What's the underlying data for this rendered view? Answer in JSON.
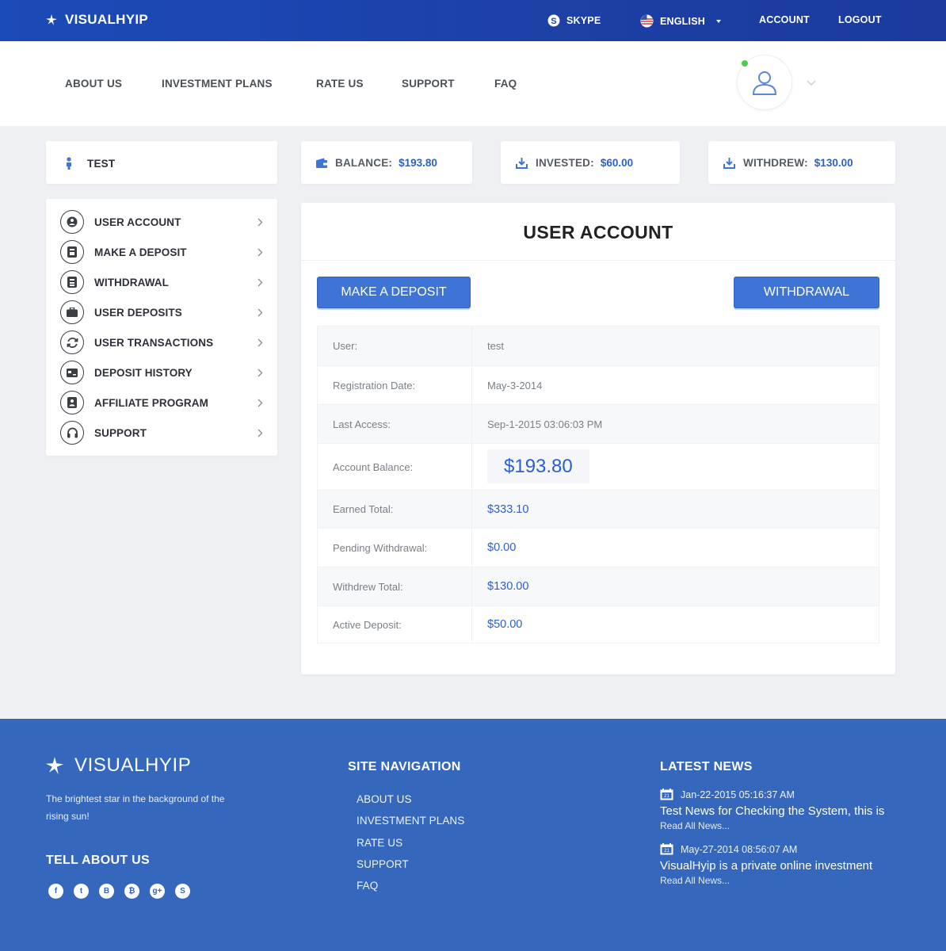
{
  "brand": {
    "name": "VISUALHYIP"
  },
  "topbar": {
    "skype_label": "SKYPE",
    "language_label": "ENGLISH",
    "account_label": "ACCOUNT",
    "logout_label": "LOGOUT"
  },
  "mainnav": {
    "items": [
      {
        "label": "ABOUT US"
      },
      {
        "label": "INVESTMENT PLANS"
      },
      {
        "label": "RATE US"
      },
      {
        "label": "SUPPORT"
      },
      {
        "label": "FAQ"
      }
    ]
  },
  "summary": {
    "username": "TEST",
    "balance_label": "BALANCE:",
    "balance_value": "$193.80",
    "invested_label": "INVESTED:",
    "invested_value": "$60.00",
    "withdrew_label": "WITHDREW:",
    "withdrew_value": "$130.00"
  },
  "sidebar": {
    "items": [
      {
        "label": "USER ACCOUNT",
        "icon": "user-icon"
      },
      {
        "label": "MAKE A DEPOSIT",
        "icon": "deposit-icon"
      },
      {
        "label": "WITHDRAWAL",
        "icon": "withdrawal-icon"
      },
      {
        "label": "USER DEPOSITS",
        "icon": "briefcase-icon"
      },
      {
        "label": "USER TRANSACTIONS",
        "icon": "refresh-icon"
      },
      {
        "label": "DEPOSIT HISTORY",
        "icon": "card-icon"
      },
      {
        "label": "AFFILIATE PROGRAM",
        "icon": "affiliate-icon"
      },
      {
        "label": "SUPPORT",
        "icon": "headphones-icon"
      }
    ]
  },
  "panel": {
    "title": "USER ACCOUNT",
    "deposit_button": "MAKE A DEPOSIT",
    "withdraw_button": "WITHDRAWAL",
    "rows": [
      {
        "label": "User:",
        "value": "test"
      },
      {
        "label": "Registration Date:",
        "value": "May-3-2014"
      },
      {
        "label": "Last Access:",
        "value": "Sep-1-2015 03:06:03 PM"
      },
      {
        "label": "Account Balance:",
        "value": "$193.80"
      },
      {
        "label": "Earned Total:",
        "value": "$333.10"
      },
      {
        "label": "Pending Withdrawal:",
        "value": "$0.00"
      },
      {
        "label": "Withdrew Total:",
        "value": "$130.00"
      },
      {
        "label": "Active Deposit:",
        "value": "$50.00"
      }
    ]
  },
  "footer": {
    "brand": "VISUALHYIP",
    "tagline": "The brightest star in the background of the rising sun!",
    "tell_heading": "TELL ABOUT US",
    "social": [
      "facebook-icon",
      "twitter-icon",
      "blogger-icon",
      "bitcoin-icon",
      "google-plus-icon",
      "skype-icon"
    ],
    "nav_heading": "SITE NAVIGATION",
    "nav_items": [
      "ABOUT US",
      "INVESTMENT PLANS",
      "RATE US",
      "SUPPORT",
      "FAQ"
    ],
    "news_heading": "LATEST NEWS",
    "news": [
      {
        "date": "Jan-22-2015 05:16:37 AM",
        "title": "Test News for Checking the System, this is",
        "more": "Read All News..."
      },
      {
        "date": "May-27-2014 08:56:07 AM",
        "title": "VisualHyip is a private online investment",
        "more": "Read All News..."
      }
    ]
  },
  "colors": {
    "primary": "#3d74d6",
    "topbar": "#1d45ad",
    "footer": "#3567bc",
    "money": "#2b5fcf"
  }
}
